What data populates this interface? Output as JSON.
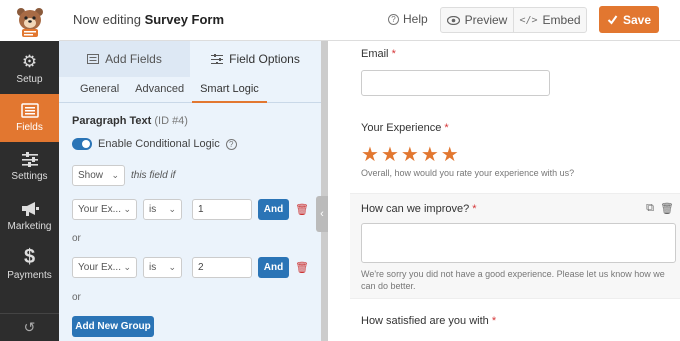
{
  "header": {
    "title_prefix": "Now editing",
    "title_form": "Survey Form",
    "help_label": "Help",
    "preview_label": "Preview",
    "embed_label": "Embed",
    "save_label": "Save"
  },
  "nav": {
    "items": [
      {
        "label": "Setup",
        "icon": "gear-icon"
      },
      {
        "label": "Fields",
        "icon": "fields-list-icon",
        "active": true
      },
      {
        "label": "Settings",
        "icon": "sliders-icon"
      },
      {
        "label": "Marketing",
        "icon": "megaphone-icon"
      },
      {
        "label": "Payments",
        "icon": "dollar-icon"
      }
    ]
  },
  "panel": {
    "tab_add": "Add Fields",
    "tab_options": "Field Options",
    "subtabs": [
      "General",
      "Advanced",
      "Smart Logic"
    ],
    "field_name": "Paragraph Text",
    "field_id": "(ID #4)",
    "enable_label": "Enable Conditional Logic",
    "show_select": "Show",
    "this_field_if": "this field if",
    "rules": [
      {
        "field": "Your Ex...",
        "operator": "is",
        "value": "1",
        "and": "And"
      },
      {
        "field": "Your Ex...",
        "operator": "is",
        "value": "2",
        "and": "And"
      }
    ],
    "or_label": "or",
    "add_group": "Add New Group"
  },
  "form": {
    "email_label": "Email",
    "experience_label": "Your Experience",
    "experience_desc": "Overall, how would you rate your experience with us?",
    "stars": 5,
    "improve_label": "How can we improve?",
    "improve_desc": "We're sorry you did not have a good experience. Please let us know how we can do better.",
    "satisfied_label": "How satisfied are you with",
    "required_mark": "*"
  },
  "colors": {
    "accent": "#e27730",
    "blue": "#2a74b6",
    "nav_bg": "#2d2d2d",
    "panel_bg": "#ebf3fb"
  }
}
